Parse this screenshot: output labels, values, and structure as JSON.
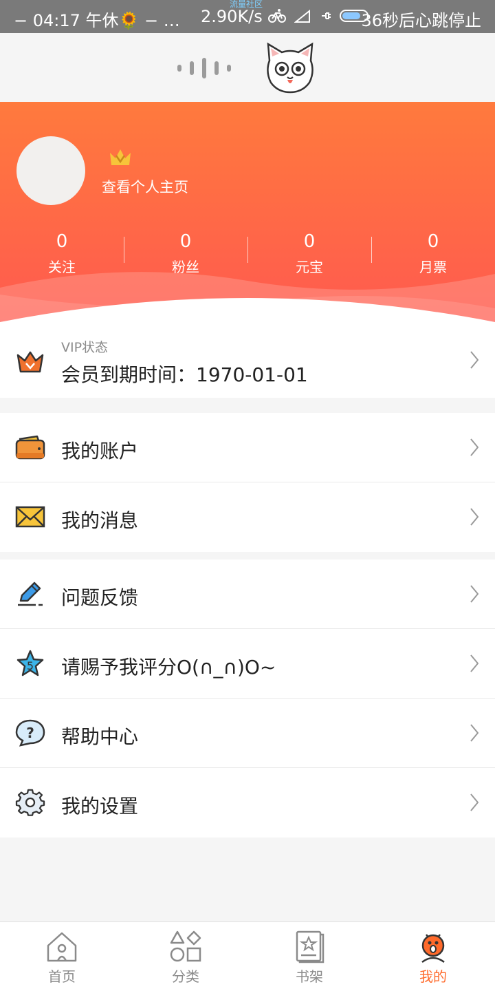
{
  "status_bar": {
    "left_text": "− 04:17   午休🌻  − …",
    "net_speed": "2.90K/s",
    "overlay_text": "流量社区",
    "right_text": "36秒后心跳停止"
  },
  "profile": {
    "view_profile_label": "查看个人主页",
    "stats": [
      {
        "value": "0",
        "label": "关注"
      },
      {
        "value": "0",
        "label": "粉丝"
      },
      {
        "value": "0",
        "label": "元宝"
      },
      {
        "value": "0",
        "label": "月票"
      }
    ]
  },
  "vip": {
    "title": "VIP状态",
    "expiry": "会员到期时间：1970-01-01"
  },
  "menu_group_1": [
    {
      "label": "我的账户",
      "icon": "wallet-icon"
    },
    {
      "label": "我的消息",
      "icon": "envelope-icon"
    }
  ],
  "menu_group_2": [
    {
      "label": "问题反馈",
      "icon": "pencil-icon"
    },
    {
      "label": "请赐予我评分O(∩_∩)O~",
      "icon": "star-icon"
    },
    {
      "label": "帮助中心",
      "icon": "help-icon"
    },
    {
      "label": "我的设置",
      "icon": "gear-icon"
    }
  ],
  "bottom_nav": [
    {
      "label": "首页",
      "icon": "home-icon"
    },
    {
      "label": "分类",
      "icon": "category-icon"
    },
    {
      "label": "书架",
      "icon": "bookshelf-icon"
    },
    {
      "label": "我的",
      "icon": "profile-face-icon",
      "active": true
    }
  ],
  "colors": {
    "accent": "#ff6a2b",
    "banner_top": "#ff7a3d",
    "banner_bottom": "#ff5a4f"
  }
}
